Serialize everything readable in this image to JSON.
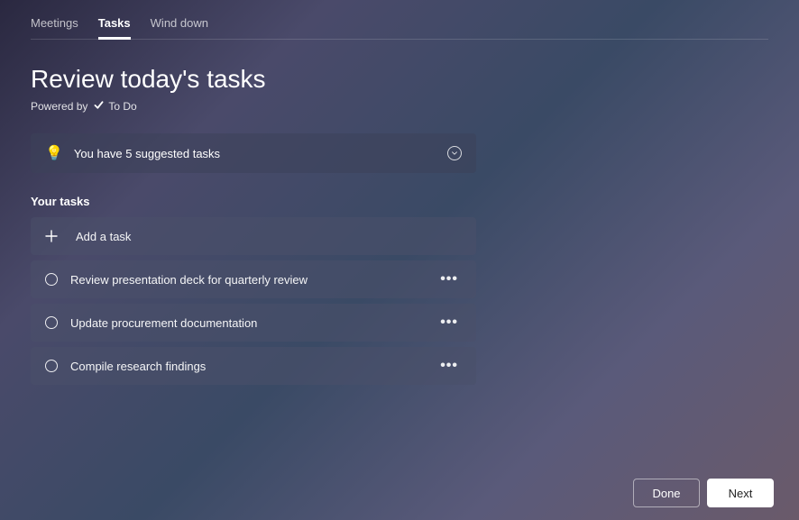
{
  "tabs": {
    "meetings": "Meetings",
    "tasks": "Tasks",
    "wind_down": "Wind down"
  },
  "header": {
    "title": "Review today's tasks",
    "powered_prefix": "Powered by",
    "powered_app": "To Do"
  },
  "suggested": {
    "text": "You have 5 suggested tasks"
  },
  "section": {
    "your_tasks": "Your tasks",
    "add_task": "Add a task"
  },
  "tasks": [
    {
      "title": "Review presentation deck for quarterly review"
    },
    {
      "title": "Update procurement documentation"
    },
    {
      "title": "Compile research findings"
    }
  ],
  "footer": {
    "done": "Done",
    "next": "Next"
  }
}
